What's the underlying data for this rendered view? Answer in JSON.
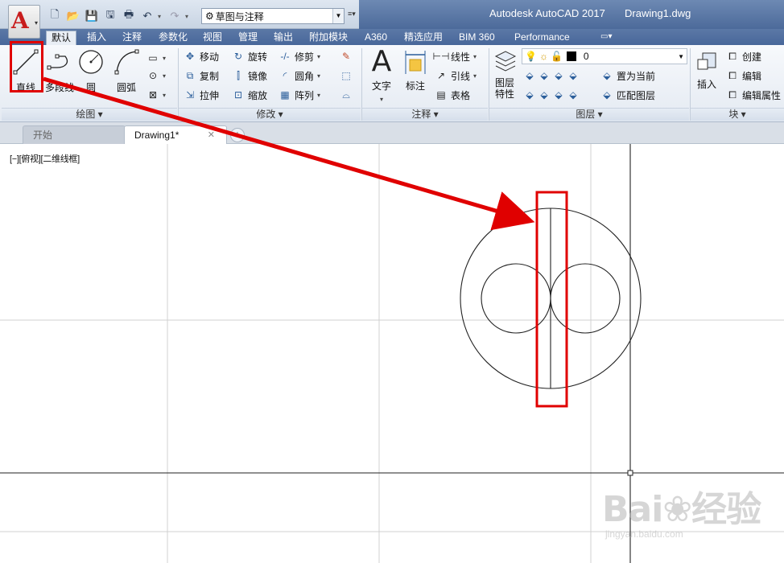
{
  "titlebar": {
    "workspace": "草图与注释",
    "app_title": "Autodesk AutoCAD 2017",
    "doc_title": "Drawing1.dwg"
  },
  "ribbon_tabs": [
    "默认",
    "插入",
    "注释",
    "参数化",
    "视图",
    "管理",
    "输出",
    "附加模块",
    "A360",
    "精选应用",
    "BIM 360",
    "Performance"
  ],
  "draw_panel": {
    "title": "绘图",
    "line": "直线",
    "polyline": "多段线",
    "circle": "圆",
    "arc": "圆弧"
  },
  "modify_panel": {
    "title": "修改",
    "move": "移动",
    "rotate": "旋转",
    "trim": "修剪",
    "copy": "复制",
    "mirror": "镜像",
    "fillet": "圆角",
    "stretch": "拉伸",
    "scale": "缩放",
    "array": "阵列"
  },
  "annotation_panel": {
    "title": "注释",
    "text": "文字",
    "dimension": "标注",
    "linear": "线性",
    "leader": "引线",
    "table": "表格"
  },
  "layers_panel": {
    "title": "图层",
    "layer_props": "图层\n特性",
    "current_layer": "0",
    "set_current": "置为当前",
    "match_layer": "匹配图层"
  },
  "block_panel": {
    "title": "块",
    "insert": "插入",
    "create": "创建",
    "edit": "编辑",
    "edit_attr": "编辑属性"
  },
  "file_tabs": {
    "start": "开始",
    "drawing": "Drawing1*"
  },
  "viewport_label": "[−][俯视][二维线框]",
  "watermark": {
    "main": "Bai❀经验",
    "sub": "jingyan.baidu.com"
  },
  "colors": {
    "highlight": "#e00000",
    "ribbon_tab_bg": "#4e6d9d",
    "titlebar_right": "#5676a6"
  }
}
